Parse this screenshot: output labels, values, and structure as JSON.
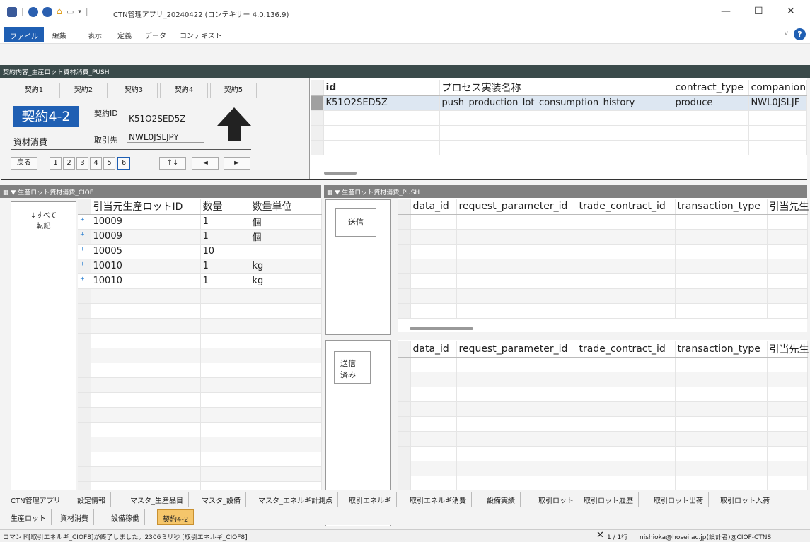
{
  "app": {
    "title": "CTN管理アプリ_20240422 (コンテキサー 4.0.136.9)",
    "help_label": "?"
  },
  "menu": [
    "ファイル",
    "編集",
    "表示",
    "定義",
    "データ",
    "コンテキスト"
  ],
  "contract_panel": {
    "header": "契約内容_生産ロット資材消費_PUSH",
    "tabs": [
      "契約1",
      "契約2",
      "契約3",
      "契約4",
      "契約5"
    ],
    "current_contract": "契約4-2",
    "contract_type_label": "資材消費",
    "contract_id_label": "契約ID",
    "contract_id_value": "K51O2SED5Z",
    "partner_label": "取引先",
    "partner_value": "NWL0JSLJPY",
    "nav": {
      "back": "戻る",
      "pages": [
        "1",
        "2",
        "3",
        "4",
        "5",
        "6"
      ],
      "active_page": "6",
      "sort": "↑↓",
      "prev": "◄",
      "next": "►"
    }
  },
  "contract_grid": {
    "columns": [
      "id",
      "プロセス実装名称",
      "contract_type",
      "companion"
    ],
    "rows": [
      [
        "K51O2SED5Z",
        "push_production_lot_consumption_history",
        "produce",
        "NWL0JSLJF"
      ]
    ]
  },
  "ciof_panel": {
    "header": "生産ロット資材消費_CIOF",
    "transfer_all_button": "↓すべて\n転記",
    "columns": [
      "引当元生産ロットID",
      "数量",
      "数量単位"
    ],
    "rows": [
      [
        "10009",
        "1",
        "個"
      ],
      [
        "10009",
        "1",
        "個"
      ],
      [
        "10005",
        "10",
        ""
      ],
      [
        "10010",
        "1",
        "kg"
      ],
      [
        "10010",
        "1",
        "kg"
      ]
    ]
  },
  "push_panel": {
    "header": "生産ロット資材消費_PUSH",
    "send_button": "送信",
    "sent_button": "送信\n済み",
    "columns": [
      "data_id",
      "request_parameter_id",
      "trade_contract_id",
      "transaction_type",
      "引当先生"
    ]
  },
  "bottom_tabs_row1": [
    "CTN管理アプリ",
    "設定情報",
    "マスタ_生産品目",
    "マスタ_設備",
    "マスタ_エネルギ計測点",
    "取引エネルギ",
    "取引エネルギ消費",
    "設備実績",
    "取引ロット",
    "取引ロット履歴",
    "取引ロット出荷",
    "取引ロット入荷"
  ],
  "bottom_tabs_row2": [
    "生産ロット",
    "資材消費",
    "設備稼働",
    "契約4-2"
  ],
  "status": {
    "message": "コマンド[取引エネルギ_CIOF8]が終了しました。2306ミリ秒 [取引エネルギ_CIOF8]",
    "rows": "1 / 1行",
    "user": "nishioka@hosei.ac.jp(設計者)@CIOF-CTNS"
  },
  "colors": {
    "accent": "#1f5fb3",
    "panel_header_dark": "#3a4a4a",
    "panel_header_gray": "#808080",
    "active_tab": "#f5c66b"
  }
}
